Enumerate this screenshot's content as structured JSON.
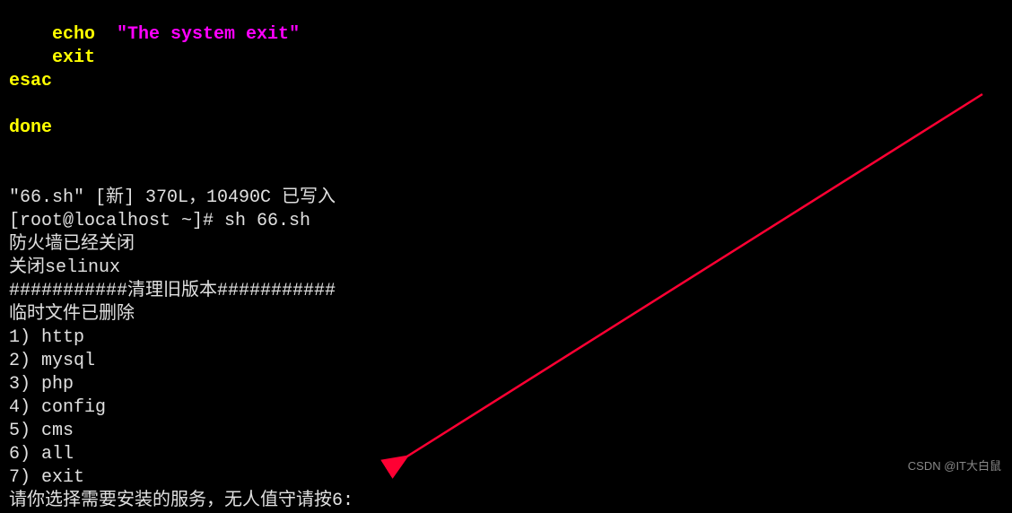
{
  "script": {
    "line1a": "    echo  ",
    "line1b": "\"The system exit\"",
    "line2": "    exit",
    "line3": "esac",
    "line4": "",
    "line5": "done"
  },
  "output": {
    "saved": "\"66.sh\" [新] 370L，10490C 已写入",
    "prompt": "[root@localhost ~]# sh 66.sh",
    "line1": "防火墙已经关闭",
    "line2": "关闭selinux",
    "line3": "###########清理旧版本###########",
    "line4": "临时文件已删除",
    "menu1": "1) http",
    "menu2": "2) mysql",
    "menu3": "3) php",
    "menu4": "4) config",
    "menu5": "5) cms",
    "menu6": "6) all",
    "menu7": "7) exit",
    "promptQuestion": "请你选择需要安装的服务，无人值守请按6: "
  },
  "watermark": "CSDN @IT大白鼠"
}
